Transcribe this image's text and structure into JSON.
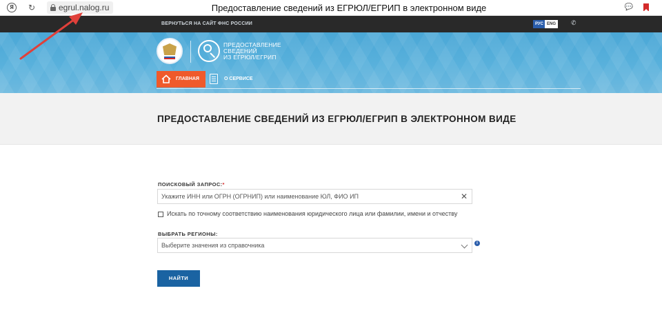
{
  "browser": {
    "url": "egrul.nalog.ru",
    "page_title": "Предоставление сведений из ЕГРЮЛ/ЕГРИП в электронном виде"
  },
  "topbar": {
    "back_link": "ВЕРНУТЬСЯ НА САЙТ ФНС РОССИИ",
    "lang_ru": "РУС",
    "lang_en": "ENG"
  },
  "header": {
    "brand_lines": [
      "ПРЕДОСТАВЛЕНИЕ",
      "СВЕДЕНИЙ",
      "ИЗ ЕГРЮЛ/ЕГРИП"
    ],
    "nav": {
      "home": "ГЛАВНАЯ",
      "about": "О СЕРВИСЕ"
    }
  },
  "main": {
    "heading": "ПРЕДОСТАВЛЕНИЕ СВЕДЕНИЙ ИЗ ЕГРЮЛ/ЕГРИП В ЭЛЕКТРОННОМ ВИДЕ",
    "query_label": "ПОИСКОВЫЙ ЗАПРОС:",
    "query_required": "*",
    "query_placeholder": "Укажите ИНН или ОГРН (ОГРНИП) или наименование ЮЛ, ФИО ИП",
    "exact_match_label": "Искать по точному соответствию наименования юридического лица или фамилии, имени и отчеству",
    "region_label": "ВЫБРАТЬ РЕГИОНЫ:",
    "region_placeholder": "Выберите значения из справочника",
    "info_icon_text": "i",
    "submit": "НАЙТИ"
  },
  "colors": {
    "accent_orange": "#ef5a2b",
    "button_blue": "#1a63a2",
    "header_blue": "#4aa7d6",
    "annotation_red": "#e0403a"
  }
}
